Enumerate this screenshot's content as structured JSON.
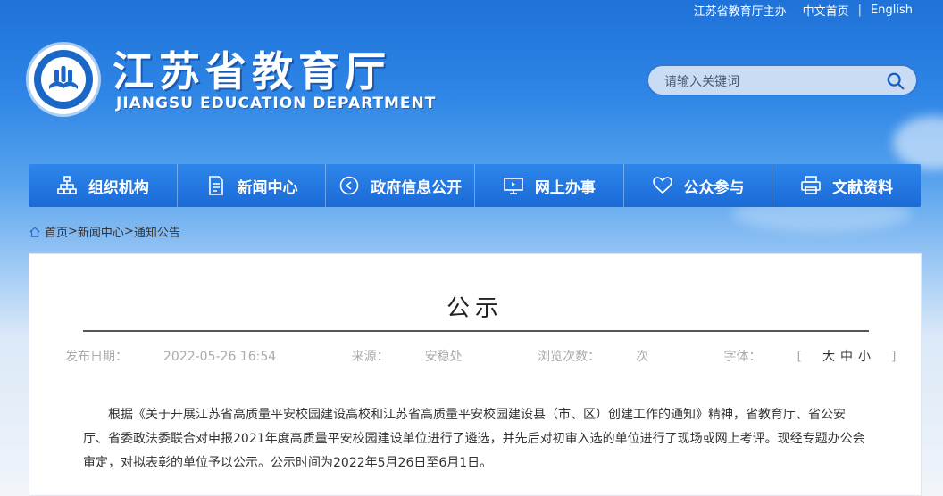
{
  "toplinks": {
    "host": "江苏省教育厅主办",
    "chinese": "中文首页",
    "english": "English"
  },
  "logo": {
    "title_cn": "江苏省教育厅",
    "title_en": "JIANGSU EDUCATION DEPARTMENT"
  },
  "search": {
    "placeholder": "请输入关键词",
    "icon": "search-icon"
  },
  "nav": {
    "items": [
      {
        "label": "组织机构",
        "icon": "org-chart-icon"
      },
      {
        "label": "新闻中心",
        "icon": "document-icon"
      },
      {
        "label": "政府信息公开",
        "icon": "info-badge-icon"
      },
      {
        "label": "网上办事",
        "icon": "monitor-icon"
      },
      {
        "label": "公众参与",
        "icon": "heart-icon"
      },
      {
        "label": "文献资料",
        "icon": "printer-icon"
      }
    ]
  },
  "breadcrumb": {
    "home": "首页",
    "sep": ">",
    "news": "新闻中心",
    "notice": "通知公告"
  },
  "article": {
    "title": "公示",
    "date_label": "发布日期：",
    "date": "2022-05-26 16:54",
    "source_label": "来源：",
    "source": "安稳处",
    "views_label": "浏览次数：",
    "views_unit": "次",
    "font_label": "字体：",
    "font_large": "大",
    "font_medium": "中",
    "font_small": "小",
    "body": "根据《关于开展江苏省高质量平安校园建设高校和江苏省高质量平安校园建设县（市、区）创建工作的通知》精神，省教育厅、省公安厅、省委政法委联合对申报2021年度高质量平安校园建设单位进行了遴选，并先后对初审入选的单位进行了现场或网上考评。现经专题办公会审定，对拟表彰的单位予以公示。公示时间为2022年5月26日至6月1日。"
  },
  "colors": {
    "nav_bg": "#1f74dc",
    "header_top": "#1f72d8",
    "title_text": "#222222"
  }
}
